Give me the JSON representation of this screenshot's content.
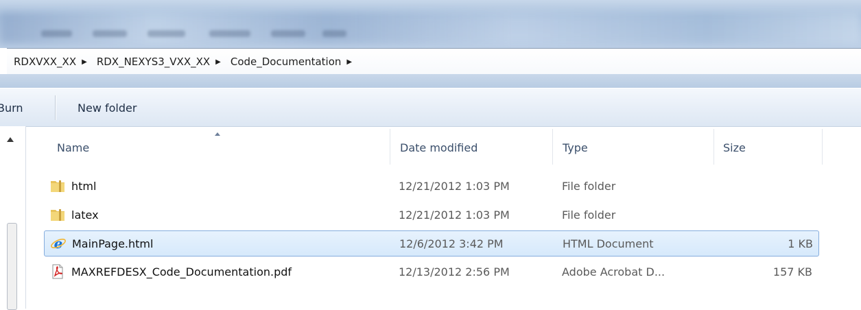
{
  "address_bar": {
    "breadcrumbs": [
      "RDXVXX_XX",
      "RDX_NEXYS3_VXX_XX",
      "Code_Documentation"
    ]
  },
  "toolbar": {
    "burn_label": "Burn",
    "new_folder_label": "New folder"
  },
  "columns": {
    "name": "Name",
    "date_modified": "Date modified",
    "type": "Type",
    "size": "Size"
  },
  "files": [
    {
      "name": "html",
      "date": "12/21/2012 1:03 PM",
      "type": "File folder",
      "size": "",
      "icon": "folder-icon",
      "selected": false
    },
    {
      "name": "latex",
      "date": "12/21/2012 1:03 PM",
      "type": "File folder",
      "size": "",
      "icon": "folder-icon",
      "selected": false
    },
    {
      "name": "MainPage.html",
      "date": "12/6/2012 3:42 PM",
      "type": "HTML Document",
      "size": "1 KB",
      "icon": "internet-explorer-icon",
      "selected": true
    },
    {
      "name": "MAXREFDESX_Code_Documentation.pdf",
      "date": "12/13/2012 2:56 PM",
      "type": "Adobe Acrobat D...",
      "size": "157 KB",
      "icon": "pdf-icon",
      "selected": false
    }
  ],
  "colors": {
    "selection_fill": "#d6e9fb",
    "selection_border": "#84acdd",
    "header_text": "#3b4f6b"
  }
}
